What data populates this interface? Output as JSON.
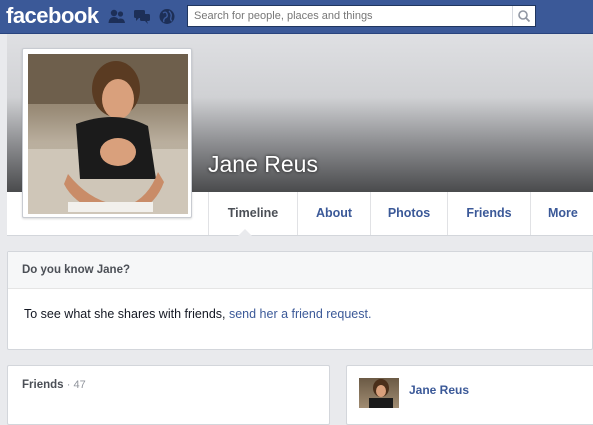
{
  "header": {
    "logo": "facebook",
    "search_placeholder": "Search for people, places and things",
    "jewels": [
      "friend-requests-icon",
      "messages-icon",
      "notifications-icon"
    ]
  },
  "profile": {
    "name": "Jane Reus",
    "tabs": [
      "Timeline",
      "About",
      "Photos",
      "Friends",
      "More"
    ],
    "active_tab": "Timeline"
  },
  "know_panel": {
    "title": "Do you know Jane?",
    "body_text": "To see what she shares with friends, ",
    "link_text": "send her a friend request."
  },
  "friends_panel": {
    "title": "Friends",
    "count": "· 47"
  },
  "post": {
    "author": "Jane Reus"
  },
  "colors": {
    "brand": "#3b5998",
    "background": "#e9eaed",
    "link": "#3b5998"
  }
}
